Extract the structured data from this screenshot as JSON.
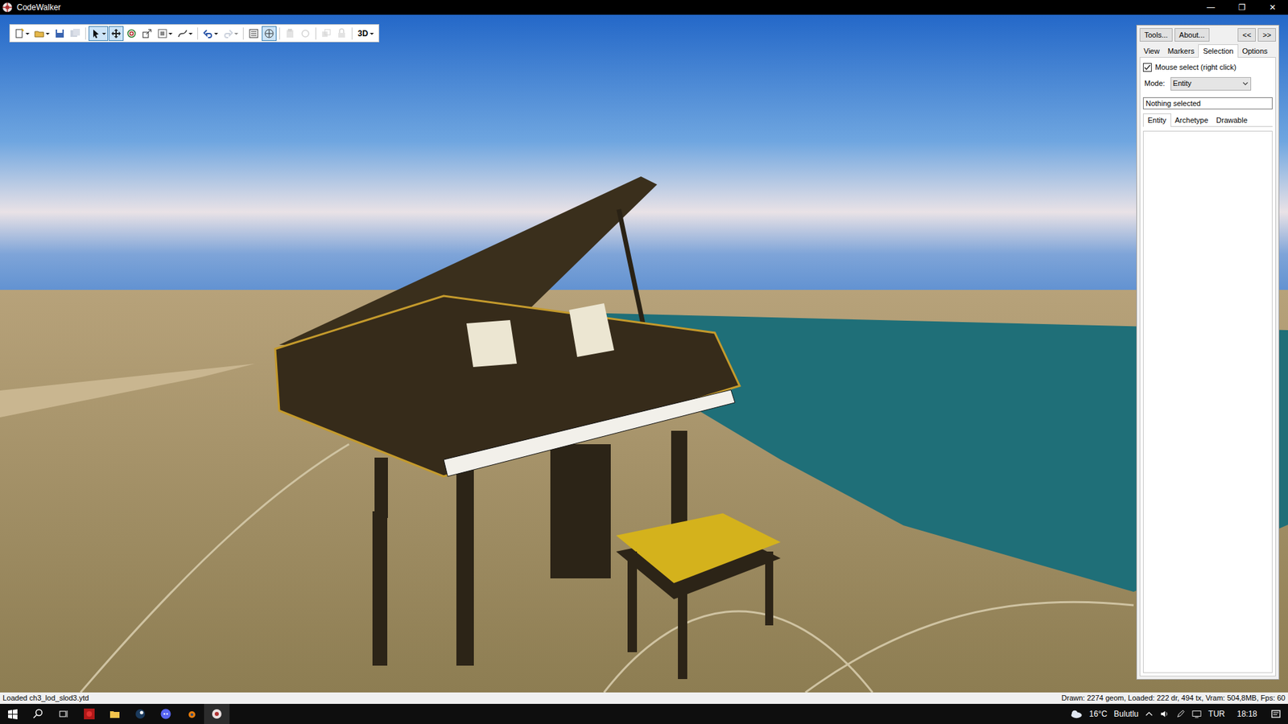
{
  "window": {
    "title": "CodeWalker",
    "controls": [
      "—",
      "❐",
      "✕"
    ]
  },
  "toolbar": {
    "buttons": [
      {
        "selected": false,
        "disabled": false,
        "dropdown": true
      },
      {
        "selected": false,
        "disabled": false,
        "dropdown": true
      },
      {
        "selected": false,
        "disabled": false,
        "dropdown": false
      },
      {
        "selected": false,
        "disabled": true,
        "dropdown": false
      },
      {
        "selected": true,
        "disabled": false,
        "dropdown": true
      },
      {
        "selected": true,
        "disabled": false,
        "dropdown": false
      },
      {
        "selected": false,
        "disabled": false,
        "dropdown": false
      },
      {
        "selected": false,
        "disabled": false,
        "dropdown": false
      },
      {
        "selected": false,
        "disabled": false,
        "dropdown": true
      },
      {
        "selected": false,
        "disabled": false,
        "dropdown": true
      },
      {
        "selected": false,
        "disabled": false,
        "dropdown": true
      },
      {
        "selected": false,
        "disabled": true,
        "dropdown": true
      },
      {
        "selected": false,
        "disabled": false,
        "dropdown": false
      },
      {
        "selected": true,
        "disabled": false,
        "dropdown": false
      },
      {
        "selected": false,
        "disabled": true,
        "dropdown": false
      },
      {
        "selected": false,
        "disabled": true,
        "dropdown": false
      },
      {
        "selected": false,
        "disabled": true,
        "dropdown": false
      },
      {
        "selected": false,
        "disabled": true,
        "dropdown": false
      }
    ],
    "view_mode": "3D"
  },
  "panel": {
    "buttons": [
      "Tools...",
      "About...",
      "<<",
      ">>"
    ],
    "tabs": [
      {
        "label": "View",
        "selected": false
      },
      {
        "label": "Markers",
        "selected": false
      },
      {
        "label": "Selection",
        "selected": true
      },
      {
        "label": "Options",
        "selected": false
      }
    ],
    "mouse_select": {
      "label": "Mouse select (right click)",
      "checked": true
    },
    "mode": {
      "label": "Mode:",
      "value": "Entity"
    },
    "selection_text": "Nothing selected",
    "subtabs": [
      {
        "label": "Entity",
        "selected": true
      },
      {
        "label": "Archetype",
        "selected": false
      },
      {
        "label": "Drawable",
        "selected": false
      }
    ]
  },
  "status_bar": {
    "left": "Loaded ch3_lod_slod3.ytd",
    "right": "Drawn: 2274 geom, Loaded: 222 dr, 494 tx, Vram: 504,8MB, Fps: 60"
  },
  "taskbar": {
    "weather": "16°C",
    "condition": "Bulutlu",
    "language": "TUR",
    "time": "18:18"
  }
}
